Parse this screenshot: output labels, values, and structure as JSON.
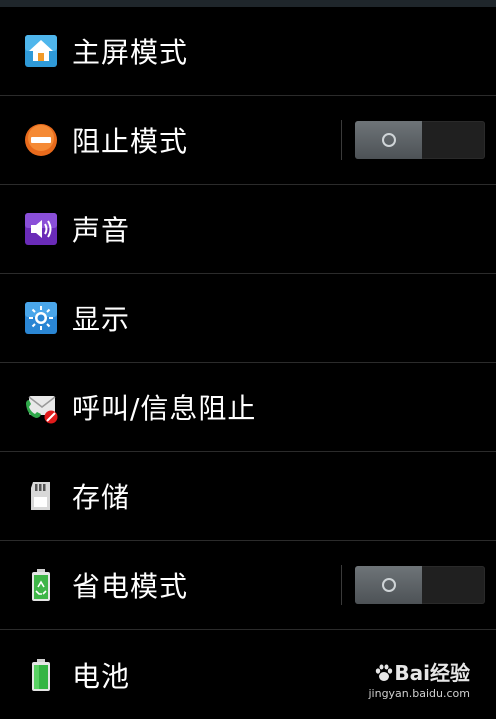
{
  "settings": {
    "items": [
      {
        "label": "主屏模式",
        "icon": "home-icon"
      },
      {
        "label": "阻止模式",
        "icon": "block-icon",
        "toggle": {
          "state": "off",
          "knob_symbol": "O"
        }
      },
      {
        "label": "声音",
        "icon": "speaker-icon"
      },
      {
        "label": "显示",
        "icon": "brightness-icon"
      },
      {
        "label": "呼叫/信息阻止",
        "icon": "call-message-block-icon"
      },
      {
        "label": "存储",
        "icon": "sd-card-icon"
      },
      {
        "label": "省电模式",
        "icon": "power-saving-icon",
        "toggle": {
          "state": "off",
          "knob_symbol": "O"
        }
      },
      {
        "label": "电池",
        "icon": "battery-icon"
      }
    ]
  },
  "watermark": {
    "brand": "Bai经验",
    "url": "jingyan.baidu.com"
  },
  "colors": {
    "background": "#000000",
    "text": "#ffffff",
    "divider": "#2b2b2b",
    "toggle_knob": "#5f6569"
  }
}
